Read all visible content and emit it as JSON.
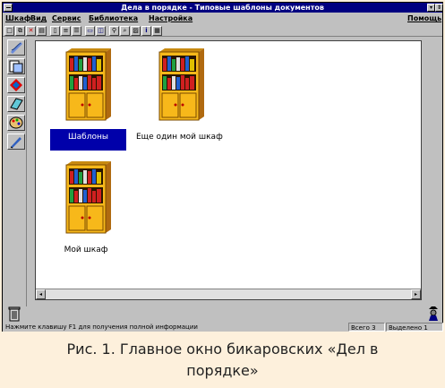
{
  "window": {
    "title": "Дела в порядке - Типовые шаблоны документов"
  },
  "menu": {
    "items": [
      "Шкаф",
      "Вид",
      "Сервис",
      "Библиотека",
      "Настройка"
    ],
    "help": "Помощь"
  },
  "toolbar": {
    "buttons": [
      "new-icon",
      "copy-icon",
      "delete-icon",
      "properties-icon",
      "doc-icon",
      "tree-icon",
      "tree2-icon",
      "window-icon",
      "window2-icon",
      "find-icon",
      "zoom-icon",
      "image-icon",
      "info-icon",
      "grid-icon"
    ]
  },
  "leftbar": {
    "buttons": [
      "quill-icon",
      "papers-icon",
      "arrows-icon",
      "notebook-icon",
      "palette-icon",
      "pen-icon"
    ]
  },
  "cabinets": [
    {
      "label": "Шаблоны",
      "selected": true
    },
    {
      "label": "Еще один мой шкаф",
      "selected": false
    },
    {
      "label": "Мой шкаф",
      "selected": false
    }
  ],
  "status": {
    "hint": "Нажмите клавишу F1 для получения полной информации",
    "total": "Всего 3",
    "selected": "Выделено 1"
  },
  "caption": {
    "line1": "Рис. 1. Главное окно бикаровских «Дел в",
    "line2": "порядке»"
  },
  "colors": {
    "titlebar": "#000080",
    "selection": "#0000aa",
    "cabinet": "#f7b81a",
    "cabinet_dark": "#b06a10"
  }
}
